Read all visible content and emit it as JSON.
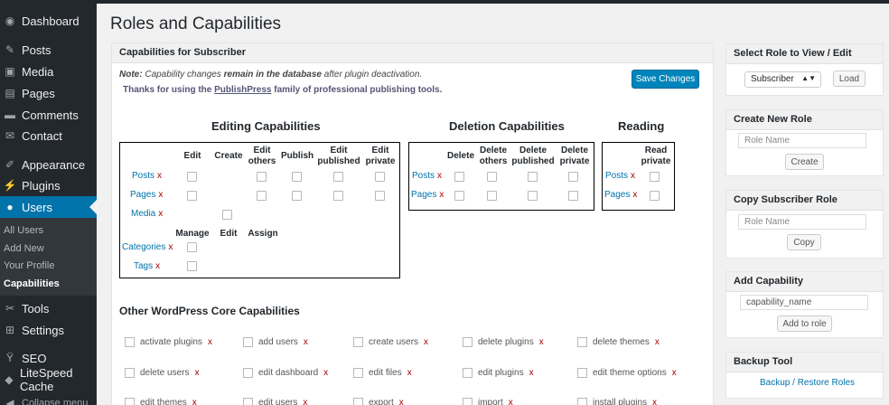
{
  "sidebar": {
    "items": [
      {
        "label": "Dashboard",
        "icon": "dashboard-icon",
        "glyph": "◉"
      },
      {
        "label": "Posts",
        "icon": "pin-icon",
        "glyph": "✎"
      },
      {
        "label": "Media",
        "icon": "media-icon",
        "glyph": "▣"
      },
      {
        "label": "Pages",
        "icon": "pages-icon",
        "glyph": "▤"
      },
      {
        "label": "Comments",
        "icon": "comments-icon",
        "glyph": "▬"
      },
      {
        "label": "Contact",
        "icon": "mail-icon",
        "glyph": "✉"
      },
      {
        "label": "Appearance",
        "icon": "brush-icon",
        "glyph": "✐"
      },
      {
        "label": "Plugins",
        "icon": "plugin-icon",
        "glyph": "⚡"
      },
      {
        "label": "Users",
        "icon": "user-icon",
        "glyph": "●"
      },
      {
        "label": "Tools",
        "icon": "wrench-icon",
        "glyph": "✂"
      },
      {
        "label": "Settings",
        "icon": "settings-icon",
        "glyph": "⊞"
      },
      {
        "label": "SEO",
        "icon": "yoast-icon",
        "glyph": "Ÿ"
      },
      {
        "label": "LiteSpeed Cache",
        "icon": "litespeed-icon",
        "glyph": "◆"
      },
      {
        "label": "Collapse menu",
        "icon": "collapse-icon",
        "glyph": "◀"
      }
    ],
    "submenu": [
      "All Users",
      "Add New",
      "Your Profile",
      "Capabilities"
    ]
  },
  "page": {
    "title": "Roles and Capabilities"
  },
  "main_panel": {
    "header": "Capabilities for Subscriber",
    "note_prefix": "Note:",
    "note_mid": " Capability changes ",
    "note_bold": "remain in the database",
    "note_suffix": " after plugin deactivation.",
    "thanks_prefix": "Thanks for using the ",
    "thanks_link": "PublishPress",
    "thanks_suffix": " family of professional publishing tools.",
    "save_label": "Save Changes"
  },
  "editing": {
    "title": "Editing Capabilities",
    "headers": [
      "Edit",
      "Create",
      "Edit\nothers",
      "Publish",
      "Edit\npublished",
      "Edit\nprivate"
    ],
    "rows": [
      "Posts",
      "Pages",
      "Media"
    ],
    "taxonomy_headers": [
      "Manage",
      "Edit",
      "Assign"
    ],
    "taxonomy_rows": [
      "Categories",
      "Tags"
    ]
  },
  "deletion": {
    "title": "Deletion Capabilities",
    "headers": [
      "Delete",
      "Delete\nothers",
      "Delete\npublished",
      "Delete\nprivate"
    ],
    "rows": [
      "Posts",
      "Pages"
    ]
  },
  "reading": {
    "title": "Reading",
    "headers": [
      "Read\nprivate"
    ],
    "rows": [
      "Posts",
      "Pages"
    ]
  },
  "remove_mark": "x",
  "core": {
    "title": "Other WordPress Core Capabilities",
    "row1": [
      "activate plugins",
      "add users",
      "create users",
      "delete plugins",
      "delete themes"
    ],
    "row2": [
      "delete users",
      "edit dashboard",
      "edit files",
      "edit plugins",
      "edit theme options"
    ],
    "row3": [
      "edit themes",
      "edit users",
      "export",
      "import",
      "install plugins"
    ]
  },
  "right": {
    "view_role": {
      "header": "Select Role to View / Edit",
      "selected": "Subscriber",
      "button": "Load"
    },
    "create_role": {
      "header": "Create New Role",
      "placeholder": "Role Name",
      "button": "Create"
    },
    "copy_role": {
      "header": "Copy Subscriber Role",
      "placeholder": "Role Name",
      "button": "Copy"
    },
    "add_cap": {
      "header": "Add Capability",
      "placeholder": "capability_name",
      "button": "Add to role"
    },
    "backup": {
      "header": "Backup Tool",
      "link": "Backup / Restore Roles"
    }
  }
}
